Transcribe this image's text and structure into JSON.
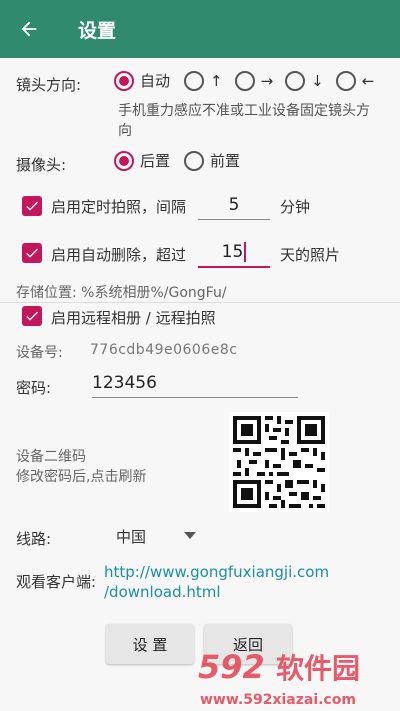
{
  "appbar": {
    "title": "设置",
    "back_icon": "arrow-left-icon",
    "color": "#2f8a6e"
  },
  "orientation": {
    "label": "镜头方向:",
    "options": [
      {
        "label": "自动",
        "selected": true
      },
      {
        "label": "↑",
        "selected": false
      },
      {
        "label": "→",
        "selected": false
      },
      {
        "label": "↓",
        "selected": false
      },
      {
        "label": "←",
        "selected": false
      }
    ],
    "note_line1": "手机重力感应不准或工业设备固定镜头方",
    "note_line2": "向"
  },
  "camera": {
    "label": "摄像头:",
    "options": [
      {
        "label": "后置",
        "selected": true
      },
      {
        "label": "前置",
        "selected": false
      }
    ]
  },
  "timer": {
    "label": "启用定时拍照，间隔",
    "value": "5",
    "unit": "分钟",
    "checked": true
  },
  "autodelete": {
    "label": "启用自动删除，超过",
    "value": "15",
    "unit": "天的照片",
    "checked": true
  },
  "storage": {
    "text": "存储位置: %系统相册%/GongFu/"
  },
  "remote": {
    "label": "启用远程相册 / 远程拍照",
    "checked": true
  },
  "device": {
    "label": "设备号:",
    "value": "776cdb49e0606e8c"
  },
  "password": {
    "label": "密码:",
    "value": "123456"
  },
  "qrcode": {
    "label": "设备二维码",
    "hint": "修改密码后,点击刷新"
  },
  "route": {
    "label": "线路:",
    "selected": "中国"
  },
  "client": {
    "label": "观看客户端:",
    "link_line1": "http://www.gongfuxiangji.com",
    "link_line2": "/download.html"
  },
  "buttons": {
    "settings": "设 置",
    "back": "返回"
  },
  "watermark": {
    "brand": "592软件园",
    "url": "www.592xiazai.com"
  },
  "colors": {
    "accent": "#c2185b",
    "link": "#1a8fa8"
  }
}
